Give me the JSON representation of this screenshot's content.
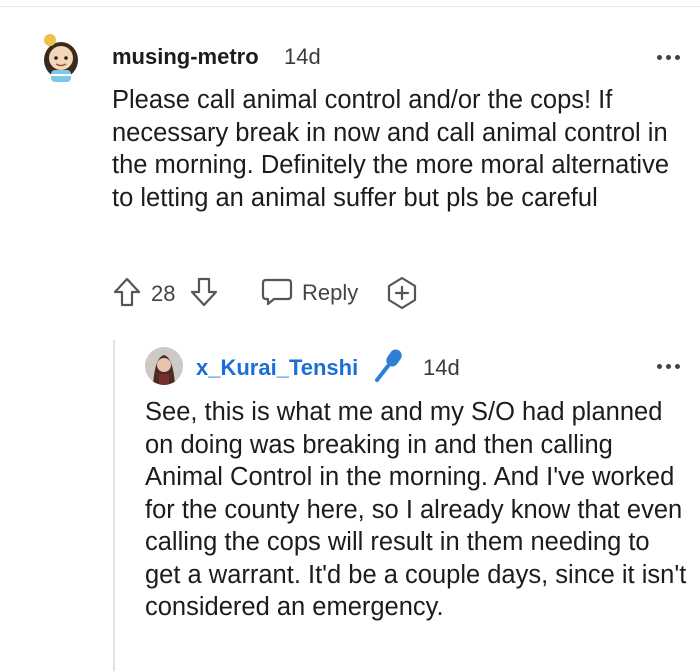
{
  "comment": {
    "username": "musing-metro",
    "age": "14d",
    "body": "Please call animal control and/or the cops! If necessary break in now and call animal control in the morning. Definitely the more moral alternative to letting an animal suffer but pls be careful",
    "votes": "28",
    "reply_label": "Reply",
    "icons": {
      "avatar": "snoo-avatar-icon",
      "upvote": "upvote-arrow-icon",
      "downvote": "downvote-arrow-icon",
      "reply": "speech-bubble-icon",
      "award": "add-award-icon",
      "more": "more-options-icon"
    }
  },
  "reply": {
    "username": "x_Kurai_Tenshi",
    "age": "14d",
    "body": "See, this is what me and my S/O had planned on doing was breaking in and then calling Animal Control in the morning. And I've worked for the county here, so I already know that even calling the cops will result in them needing to get a warrant. It'd be a couple days, since it isn't considered an emergency.",
    "icons": {
      "avatar": "user-avatar-icon",
      "badge": "microphone-icon",
      "more": "more-options-icon"
    }
  },
  "colors": {
    "reply_username": "#1a6fd6",
    "mic_badge": "#2d7fd8",
    "thread_line": "#e2e2e2"
  }
}
